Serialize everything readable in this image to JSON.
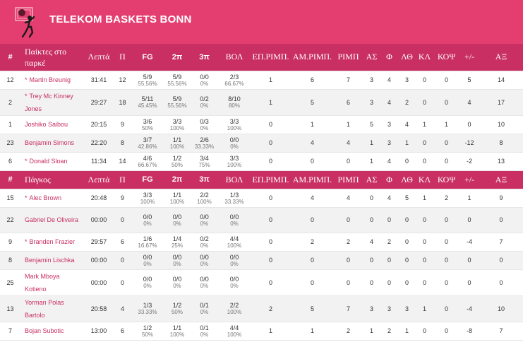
{
  "team": {
    "name": "TELEKOM BASKETS BONN"
  },
  "colors": {
    "banner": "#e43d6f",
    "header_row": "#c92f63",
    "player_name": "#c92f63"
  },
  "icons": {
    "logo": "basketball-player-logo-icon",
    "starter_marker": "*"
  },
  "headers": {
    "starters": [
      "#",
      "Παίκτες στο παρκέ",
      "Λεπτά",
      "Π",
      "FG",
      "2π",
      "3π",
      "ΒΟΛ",
      "ΕΠ.ΡΙΜΠ.",
      "ΑΜ.ΡΙΜΠ.",
      "ΡΙΜΠ",
      "ΑΣ",
      "Φ",
      "ΛΘ",
      "ΚΛ",
      "ΚΟΨ",
      "+/-",
      "ΑΞ"
    ],
    "bench": [
      "#",
      "Πάγκος",
      "Λεπτά",
      "Π",
      "FG",
      "2π",
      "3π",
      "ΒΟΛ",
      "ΕΠ.ΡΙΜΠ.",
      "ΑΜ.ΡΙΜΠ.",
      "ΡΙΜΠ",
      "ΑΣ",
      "Φ",
      "ΛΘ",
      "ΚΛ",
      "ΚΟΨ",
      "+/-",
      "ΑΞ"
    ]
  },
  "starters": [
    {
      "num": "12",
      "starter": true,
      "name": "Martin Breunig",
      "min": "31:41",
      "pts": "12",
      "fg": "5/9",
      "fg_pct": "55.56%",
      "two": "5/9",
      "two_pct": "55.56%",
      "three": "0/0",
      "three_pct": "0%",
      "ft": "2/3",
      "ft_pct": "66.67%",
      "oreb": "1",
      "dreb": "6",
      "reb": "7",
      "ast": "3",
      "pf": "4",
      "to": "3",
      "stl": "0",
      "blk": "0",
      "pm": "5",
      "eff": "14"
    },
    {
      "num": "2",
      "starter": true,
      "name": "Trey Mc Kinney Jones",
      "min": "29:27",
      "pts": "18",
      "fg": "5/11",
      "fg_pct": "45.45%",
      "two": "5/9",
      "two_pct": "55.56%",
      "three": "0/2",
      "three_pct": "0%",
      "ft": "8/10",
      "ft_pct": "80%",
      "oreb": "1",
      "dreb": "5",
      "reb": "6",
      "ast": "3",
      "pf": "4",
      "to": "2",
      "stl": "0",
      "blk": "0",
      "pm": "4",
      "eff": "17"
    },
    {
      "num": "1",
      "starter": false,
      "name": "Joshiko Saibou",
      "min": "20:15",
      "pts": "9",
      "fg": "3/6",
      "fg_pct": "50%",
      "two": "3/3",
      "two_pct": "100%",
      "three": "0/3",
      "three_pct": "0%",
      "ft": "3/3",
      "ft_pct": "100%",
      "oreb": "0",
      "dreb": "1",
      "reb": "1",
      "ast": "5",
      "pf": "3",
      "to": "4",
      "stl": "1",
      "blk": "1",
      "pm": "0",
      "eff": "10"
    },
    {
      "num": "23",
      "starter": false,
      "name": "Benjamin Simons",
      "min": "22:20",
      "pts": "8",
      "fg": "3/7",
      "fg_pct": "42.86%",
      "two": "1/1",
      "two_pct": "100%",
      "three": "2/6",
      "three_pct": "33.33%",
      "ft": "0/0",
      "ft_pct": "0%",
      "oreb": "0",
      "dreb": "4",
      "reb": "4",
      "ast": "1",
      "pf": "3",
      "to": "1",
      "stl": "0",
      "blk": "0",
      "pm": "-12",
      "eff": "8"
    },
    {
      "num": "6",
      "starter": true,
      "name": "Donald Sloan",
      "min": "11:34",
      "pts": "14",
      "fg": "4/6",
      "fg_pct": "66.67%",
      "two": "1/2",
      "two_pct": "50%",
      "three": "3/4",
      "three_pct": "75%",
      "ft": "3/3",
      "ft_pct": "100%",
      "oreb": "0",
      "dreb": "0",
      "reb": "0",
      "ast": "1",
      "pf": "4",
      "to": "0",
      "stl": "0",
      "blk": "0",
      "pm": "-2",
      "eff": "13"
    }
  ],
  "bench": [
    {
      "num": "15",
      "starter": true,
      "name": "Alec Brown",
      "min": "20:48",
      "pts": "9",
      "fg": "3/3",
      "fg_pct": "100%",
      "two": "1/1",
      "two_pct": "100%",
      "three": "2/2",
      "three_pct": "100%",
      "ft": "1/3",
      "ft_pct": "33.33%",
      "oreb": "0",
      "dreb": "4",
      "reb": "4",
      "ast": "0",
      "pf": "4",
      "to": "5",
      "stl": "1",
      "blk": "2",
      "pm": "1",
      "eff": "9"
    },
    {
      "num": "22",
      "starter": false,
      "name": "Gabriel De Oliveira",
      "min": "00:00",
      "pts": "0",
      "fg": "0/0",
      "fg_pct": "0%",
      "two": "0/0",
      "two_pct": "0%",
      "three": "0/0",
      "three_pct": "0%",
      "ft": "0/0",
      "ft_pct": "0%",
      "oreb": "0",
      "dreb": "0",
      "reb": "0",
      "ast": "0",
      "pf": "0",
      "to": "0",
      "stl": "0",
      "blk": "0",
      "pm": "0",
      "eff": "0"
    },
    {
      "num": "9",
      "starter": true,
      "name": "Branden Frazier",
      "min": "29:57",
      "pts": "6",
      "fg": "1/6",
      "fg_pct": "16.67%",
      "two": "1/4",
      "two_pct": "25%",
      "three": "0/2",
      "three_pct": "0%",
      "ft": "4/4",
      "ft_pct": "100%",
      "oreb": "0",
      "dreb": "2",
      "reb": "2",
      "ast": "4",
      "pf": "2",
      "to": "0",
      "stl": "0",
      "blk": "0",
      "pm": "-4",
      "eff": "7"
    },
    {
      "num": "8",
      "starter": false,
      "name": "Benjamin Lischka",
      "min": "00:00",
      "pts": "0",
      "fg": "0/0",
      "fg_pct": "0%",
      "two": "0/0",
      "two_pct": "0%",
      "three": "0/0",
      "three_pct": "0%",
      "ft": "0/0",
      "ft_pct": "0%",
      "oreb": "0",
      "dreb": "0",
      "reb": "0",
      "ast": "0",
      "pf": "0",
      "to": "0",
      "stl": "0",
      "blk": "0",
      "pm": "0",
      "eff": "0"
    },
    {
      "num": "25",
      "starter": false,
      "name": "Mark Mboya Kotieno",
      "min": "00:00",
      "pts": "0",
      "fg": "0/0",
      "fg_pct": "0%",
      "two": "0/0",
      "two_pct": "0%",
      "three": "0/0",
      "three_pct": "0%",
      "ft": "0/0",
      "ft_pct": "0%",
      "oreb": "0",
      "dreb": "0",
      "reb": "0",
      "ast": "0",
      "pf": "0",
      "to": "0",
      "stl": "0",
      "blk": "0",
      "pm": "0",
      "eff": "0"
    },
    {
      "num": "13",
      "starter": false,
      "name": "Yorman Polas Bartolo",
      "min": "20:58",
      "pts": "4",
      "fg": "1/3",
      "fg_pct": "33.33%",
      "two": "1/2",
      "two_pct": "50%",
      "three": "0/1",
      "three_pct": "0%",
      "ft": "2/2",
      "ft_pct": "100%",
      "oreb": "2",
      "dreb": "5",
      "reb": "7",
      "ast": "3",
      "pf": "3",
      "to": "3",
      "stl": "1",
      "blk": "0",
      "pm": "-4",
      "eff": "10"
    },
    {
      "num": "7",
      "starter": false,
      "name": "Bojan Subotic",
      "min": "13:00",
      "pts": "6",
      "fg": "1/2",
      "fg_pct": "50%",
      "two": "1/1",
      "two_pct": "100%",
      "three": "0/1",
      "three_pct": "0%",
      "ft": "4/4",
      "ft_pct": "100%",
      "oreb": "1",
      "dreb": "1",
      "reb": "2",
      "ast": "1",
      "pf": "2",
      "to": "1",
      "stl": "0",
      "blk": "0",
      "pm": "-8",
      "eff": "7"
    }
  ]
}
